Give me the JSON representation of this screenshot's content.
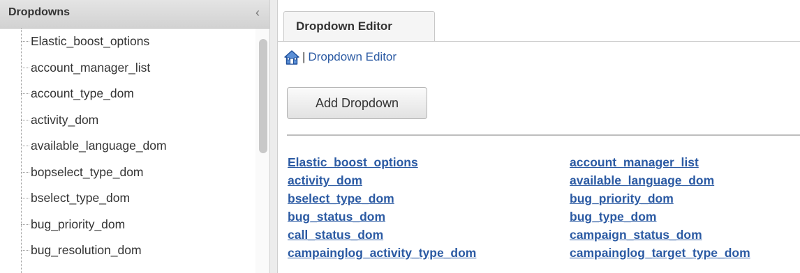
{
  "sidebar": {
    "title": "Dropdowns",
    "collapse_glyph": "‹",
    "items": [
      "Elastic_boost_options",
      "account_manager_list",
      "account_type_dom",
      "activity_dom",
      "available_language_dom",
      "bopselect_type_dom",
      "bselect_type_dom",
      "bug_priority_dom",
      "bug_resolution_dom"
    ]
  },
  "main": {
    "tab_label": "Dropdown Editor",
    "breadcrumb": {
      "home_icon": "home-icon",
      "separator": "|",
      "current": "Dropdown Editor"
    },
    "add_button_label": "Add Dropdown",
    "dropdown_links": [
      "Elastic_boost_options",
      "account_manager_list",
      "activity_dom",
      "available_language_dom",
      "bselect_type_dom",
      "bug_priority_dom",
      "bug_status_dom",
      "bug_type_dom",
      "call_status_dom",
      "campaign_status_dom",
      "campainglog_activity_type_dom",
      "campainglog_target_type_dom"
    ]
  },
  "colors": {
    "link": "#2b5aa3",
    "header_bg": "#d9d9d9",
    "text": "#333333"
  }
}
